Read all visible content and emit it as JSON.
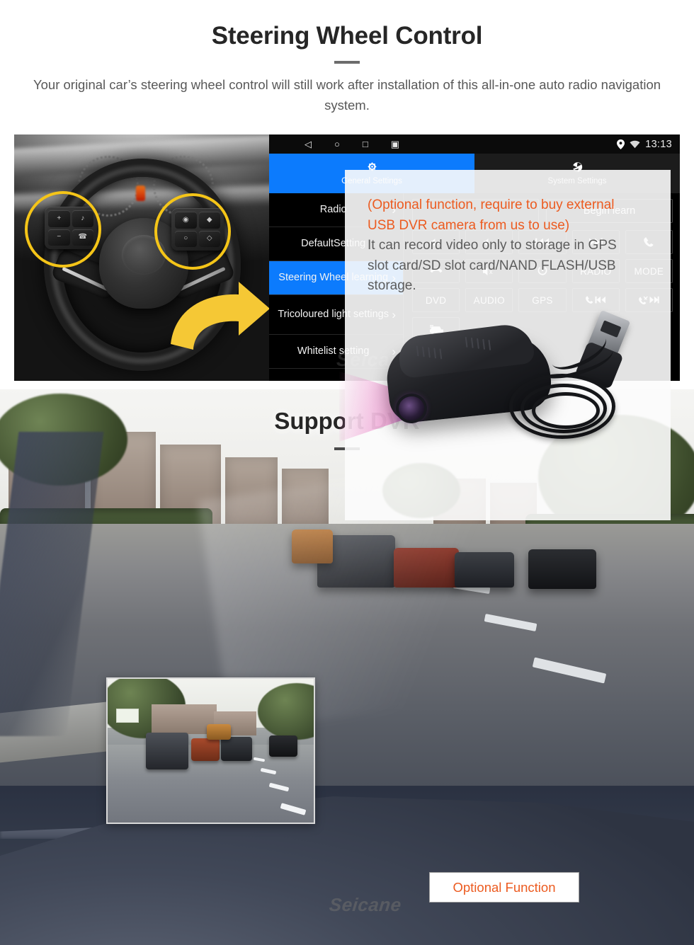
{
  "section_steering": {
    "title": "Steering Wheel Control",
    "subtitle": "Your original car’s steering wheel control will still work after installation of this all-in-one auto radio navigation system.",
    "photo_caption": "car steering wheel with two highlighted control pads and a yellow arrow pointing to the head unit screen",
    "head_unit": {
      "status_bar": {
        "back_icon": "◁",
        "home_icon": "○",
        "recents_icon": "□",
        "screenshot_icon": "▣",
        "location_icon": "location-pin",
        "wifi_icon": "wifi",
        "clock": "13:13"
      },
      "tabs": [
        {
          "label": "General Settings",
          "icon": "brightness-gear-icon",
          "active": true
        },
        {
          "label": "System Settings",
          "icon": "system-shutter-icon",
          "active": false
        }
      ],
      "sidebar": [
        {
          "label": "Radio",
          "active": false
        },
        {
          "label": "DefaultSetting",
          "active": false
        },
        {
          "label": "Steering Wheel learning",
          "active": true
        },
        {
          "label": "Tricoloured light settings",
          "active": false
        },
        {
          "label": "Whitelist setting",
          "active": false
        }
      ],
      "learn_row": {
        "input_value": "",
        "begin_learn_label": "Begin learn"
      },
      "keys": [
        {
          "label": "🔊+",
          "name": "volume-up"
        },
        {
          "label": "🔊−",
          "name": "volume-down"
        },
        {
          "label": "⏮",
          "name": "previous-track"
        },
        {
          "label": "⏭",
          "name": "next-track"
        },
        {
          "label": "✆",
          "name": "answer-call"
        },
        {
          "label": "⌕",
          "name": "hang-up"
        },
        {
          "label": "🔊 x",
          "name": "mute"
        },
        {
          "label": "⏻",
          "name": "power"
        },
        {
          "label": "RADIO",
          "name": "radio"
        },
        {
          "label": "MODE",
          "name": "mode"
        },
        {
          "label": "DVD",
          "name": "dvd"
        },
        {
          "label": "AUDIO",
          "name": "audio"
        },
        {
          "label": "GPS",
          "name": "gps"
        },
        {
          "label": "✆⏮",
          "name": "call-previous"
        },
        {
          "label": "✄⏭",
          "name": "reject-next"
        },
        {
          "label": "🚗",
          "name": "car-info"
        }
      ],
      "watermark": "Seicane"
    }
  },
  "section_dvr": {
    "title": "Support DVR",
    "panel": {
      "highlight_line_1": "(Optional function, require to buy external",
      "highlight_line_2": "USB DVR camera from us to use)",
      "normal_line_1": "It can record video only to storage in GPS",
      "normal_line_2": "slot card/SD slot card/NAND FLASH/USB",
      "normal_line_3": "storage."
    },
    "optional_button_label": "Optional Function",
    "watermark": "Seicane",
    "inset_caption": "dash cam recorded street view with traffic",
    "device_caption": "black USB DVR dash camera with coiled USB cable"
  },
  "colors": {
    "accent_blue": "#0c7bfd",
    "accent_orange": "#ec5b20",
    "highlight_yellow": "#f5c518",
    "title_dark": "#262626",
    "body_gray": "#585858"
  }
}
